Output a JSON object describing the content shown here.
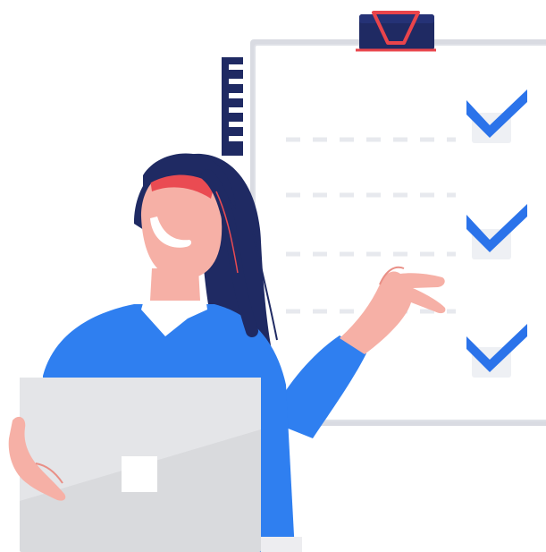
{
  "illustration": {
    "subject": "woman-with-laptop-and-checklist-clipboard",
    "checklist": {
      "rows": [
        {
          "checked": true
        },
        {
          "checked": true
        },
        {
          "checked": true
        }
      ]
    },
    "colors": {
      "navy": "#1f2a63",
      "blue": "#2f7ff0",
      "check_blue": "#2b73ea",
      "skin": "#f6b0a6",
      "skin_shadow": "#e98f86",
      "headband": "#ea4b52",
      "clip_red": "#e9444b",
      "paper": "#ffffff",
      "paper_edge": "#d9dbe2",
      "line_gray": "#e7e9ee",
      "laptop": "#d9dadd",
      "laptop_light": "#f2f2f4",
      "collar": "#ffffff"
    }
  }
}
